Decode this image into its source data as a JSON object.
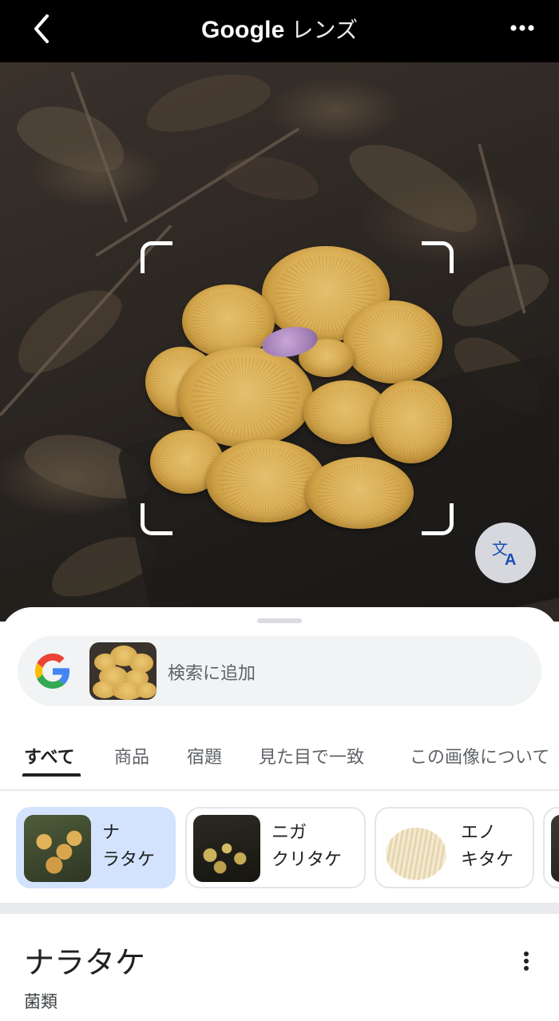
{
  "header": {
    "brand": "Google",
    "title": "レンズ",
    "back_icon": "chevron-left-icon",
    "more_icon": "more-horizontal-icon"
  },
  "photo": {
    "translate_icon": "translate-icon"
  },
  "search": {
    "hint": "検索に追加",
    "logo": "google-g-icon"
  },
  "tabs": [
    {
      "label": "すべて",
      "active": true
    },
    {
      "label": "商品"
    },
    {
      "label": "宿題"
    },
    {
      "label": "見た目で一致"
    },
    {
      "label": "この画像について"
    }
  ],
  "chips": [
    {
      "line1": "ナ",
      "line2": "ラタケ",
      "active": true
    },
    {
      "line1": "ニガ",
      "line2": "クリタケ"
    },
    {
      "line1": "エノ",
      "line2": "キタケ"
    }
  ],
  "result": {
    "title": "ナラタケ",
    "subtitle": "菌類"
  },
  "colors": {
    "active_chip": "#d3e3fd",
    "header_bg": "#000000",
    "mushroom": "#dcb158"
  }
}
